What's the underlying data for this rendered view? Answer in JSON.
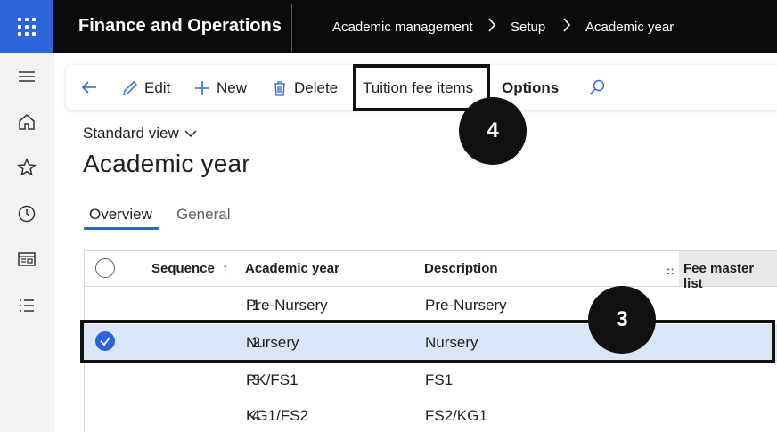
{
  "topbar": {
    "app_title": "Finance and Operations",
    "breadcrumbs": [
      "Academic management",
      "Setup",
      "Academic year"
    ]
  },
  "leftnav": {
    "items": [
      "menu-icon",
      "home-icon",
      "star-icon",
      "clock-icon",
      "workspace-icon",
      "list-icon"
    ]
  },
  "actionpane": {
    "edit": "Edit",
    "new": "New",
    "delete": "Delete",
    "tuition_fee_items": "Tuition fee items",
    "options": "Options"
  },
  "view": {
    "label": "Standard view"
  },
  "page": {
    "title": "Academic year"
  },
  "tabs": [
    {
      "label": "Overview",
      "active": true
    },
    {
      "label": "General",
      "active": false
    }
  ],
  "grid": {
    "columns": [
      "Sequence",
      "Academic year",
      "Description",
      "Fee master list"
    ],
    "rows": [
      {
        "sequence": "1",
        "year": "Pre-Nursery",
        "description": "Pre-Nursery",
        "selected": false
      },
      {
        "sequence": "2",
        "year": "Nursery",
        "description": "Nursery",
        "selected": true
      },
      {
        "sequence": "3",
        "year": "PK/FS1",
        "description": "FS1",
        "selected": false
      },
      {
        "sequence": "4",
        "year": "KG1/FS2",
        "description": "FS2/KG1",
        "selected": false
      }
    ]
  },
  "annotations": {
    "badge_a": "4",
    "badge_b": "3"
  },
  "colors": {
    "accent": "#2b65d9",
    "topbar": "#0b0b0b",
    "selected_row": "#dbe5f8"
  }
}
